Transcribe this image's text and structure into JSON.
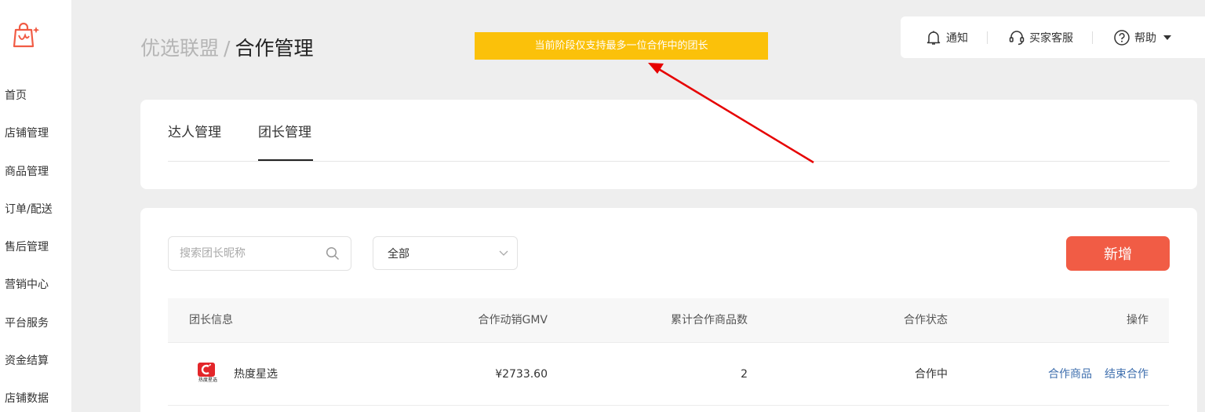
{
  "sidebar": {
    "items": [
      {
        "label": "首页"
      },
      {
        "label": "店铺管理"
      },
      {
        "label": "商品管理"
      },
      {
        "label": "订单/配送"
      },
      {
        "label": "售后管理"
      },
      {
        "label": "营销中心"
      },
      {
        "label": "平台服务"
      },
      {
        "label": "资金结算"
      },
      {
        "label": "店铺数据"
      }
    ]
  },
  "header": {
    "breadcrumb_parent": "优选联盟",
    "breadcrumb_sep": "/",
    "breadcrumb_current": "合作管理",
    "notice": "当前阶段仅支持最多一位合作中的团长"
  },
  "topbar": {
    "notify_label": "通知",
    "service_label": "买家客服",
    "help_label": "帮助"
  },
  "tabs": [
    {
      "label": "达人管理",
      "active": false
    },
    {
      "label": "团长管理",
      "active": true
    }
  ],
  "filters": {
    "search_placeholder": "搜索团长昵称",
    "status_selected": "全部",
    "add_label": "新增"
  },
  "table": {
    "columns": [
      "团长信息",
      "合作动销GMV",
      "累计合作商品数",
      "合作状态",
      "操作"
    ],
    "rows": [
      {
        "name": "热度星选",
        "avatar_text": "热度星选",
        "gmv": "¥2733.60",
        "count": "2",
        "status": "合作中",
        "ops": [
          "合作商品",
          "结束合作"
        ]
      }
    ]
  },
  "colors": {
    "accent": "#f15c45",
    "notice_bg": "#fbc10a",
    "link": "#3f6fae",
    "arrow": "#e60000"
  }
}
